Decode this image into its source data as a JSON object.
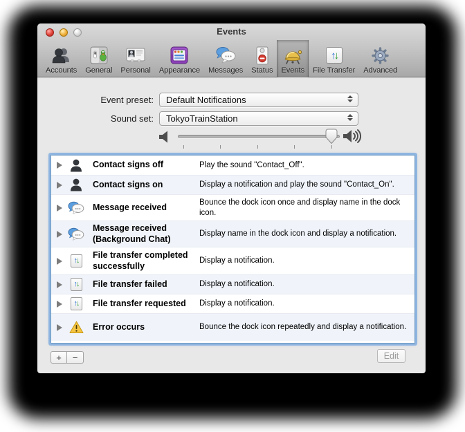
{
  "window": {
    "title": "Events"
  },
  "toolbar": {
    "items": [
      {
        "label": "Accounts",
        "icon": "accounts-icon",
        "selected": false
      },
      {
        "label": "General",
        "icon": "general-icon",
        "selected": false
      },
      {
        "label": "Personal",
        "icon": "personal-icon",
        "selected": false
      },
      {
        "label": "Appearance",
        "icon": "appearance-icon",
        "selected": false
      },
      {
        "label": "Messages",
        "icon": "messages-icon",
        "selected": false
      },
      {
        "label": "Status",
        "icon": "status-icon",
        "selected": false
      },
      {
        "label": "Events",
        "icon": "events-bell-icon",
        "selected": true
      },
      {
        "label": "File Transfer",
        "icon": "file-transfer-icon",
        "selected": false
      },
      {
        "label": "Advanced",
        "icon": "advanced-gear-icon",
        "selected": false
      }
    ]
  },
  "form": {
    "event_preset_label": "Event preset:",
    "event_preset_value": "Default Notifications",
    "sound_set_label": "Sound set:",
    "sound_set_value": "TokyoTrainStation"
  },
  "volume": {
    "value_percent": 95,
    "ticks": 5
  },
  "events": {
    "rows": [
      {
        "icon": "contact-icon",
        "title": "Contact signs off",
        "description": "Play the sound \"Contact_Off\"."
      },
      {
        "icon": "contact-icon",
        "title": "Contact signs on",
        "description": "Display a notification and play the sound \"Contact_On\"."
      },
      {
        "icon": "message-icon",
        "title": "Message received",
        "description": "Bounce the dock icon once and display name in the dock icon."
      },
      {
        "icon": "message-icon",
        "title": "Message received (Background Chat)",
        "description": "Display name in the dock icon and display a notification."
      },
      {
        "icon": "file-transfer-icon",
        "title": "File transfer completed successfully",
        "description": "Display a notification."
      },
      {
        "icon": "file-transfer-icon",
        "title": "File transfer failed",
        "description": "Display a notification."
      },
      {
        "icon": "file-transfer-icon",
        "title": "File transfer requested",
        "description": "Display a notification."
      },
      {
        "icon": "warning-icon",
        "title": "Error occurs",
        "description": "Bounce the dock icon repeatedly and display a notification."
      }
    ]
  },
  "footer": {
    "add_label": "+",
    "remove_label": "−",
    "edit_label": "Edit"
  },
  "glyphs": {
    "arrow_up": "↑",
    "arrow_down": "↓"
  },
  "colors": {
    "content_bg": "#e8e8e8",
    "alt_row": "#f0f4fa",
    "focus_ring": "#78a8de",
    "toolbar_top": "#dadada",
    "toolbar_bottom": "#a8a8a8",
    "warning_yellow": "#f6c544",
    "bell_gold": "#e8c04c"
  }
}
